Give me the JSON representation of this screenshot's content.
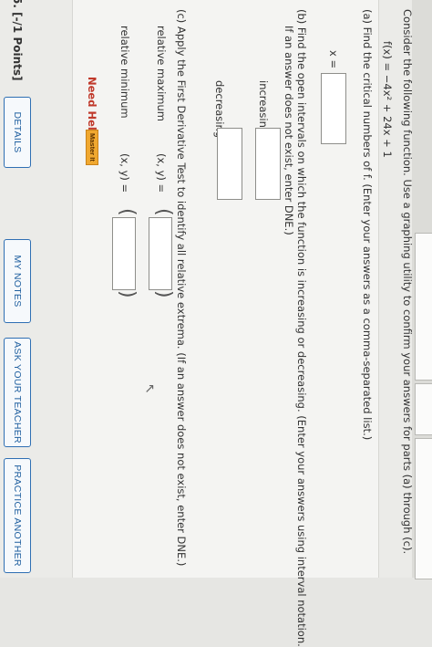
{
  "header": {
    "points": "5. [-/1 Points]",
    "details_label": "DETAILS",
    "my_notes_label": "MY NOTES",
    "ask_teacher_label": "ASK YOUR TEACHER",
    "practice_label": "PRACTICE ANOTHER"
  },
  "problem": {
    "intro": "Consider the following function. Use a graphing utility to confirm your answers for parts (a) through (c).",
    "function": "f(x) = −4x² + 24x + 1",
    "part_a": {
      "prompt": "(a)   Find the critical numbers of f. (Enter your answers as a comma-separated list.)",
      "label": "x ="
    },
    "part_b": {
      "prompt_line1": "(b)   Find the open intervals on which the function is increasing or decreasing. (Enter your answers using interval notation.",
      "prompt_line2": "If an answer does not exist, enter DNE.)",
      "increasing_label": "increasing",
      "decreasing_label": "decreasing"
    },
    "part_c": {
      "prompt": "(c)   Apply the First Derivative Test to identify all relative extrema. (If an answer does not exist, enter DNE.)",
      "max_label": "relative maximum",
      "min_label": "relative minimum",
      "coord_label": "(x, y) ="
    }
  },
  "help": {
    "need_help": "Need Help?",
    "master_it": "Master It"
  }
}
